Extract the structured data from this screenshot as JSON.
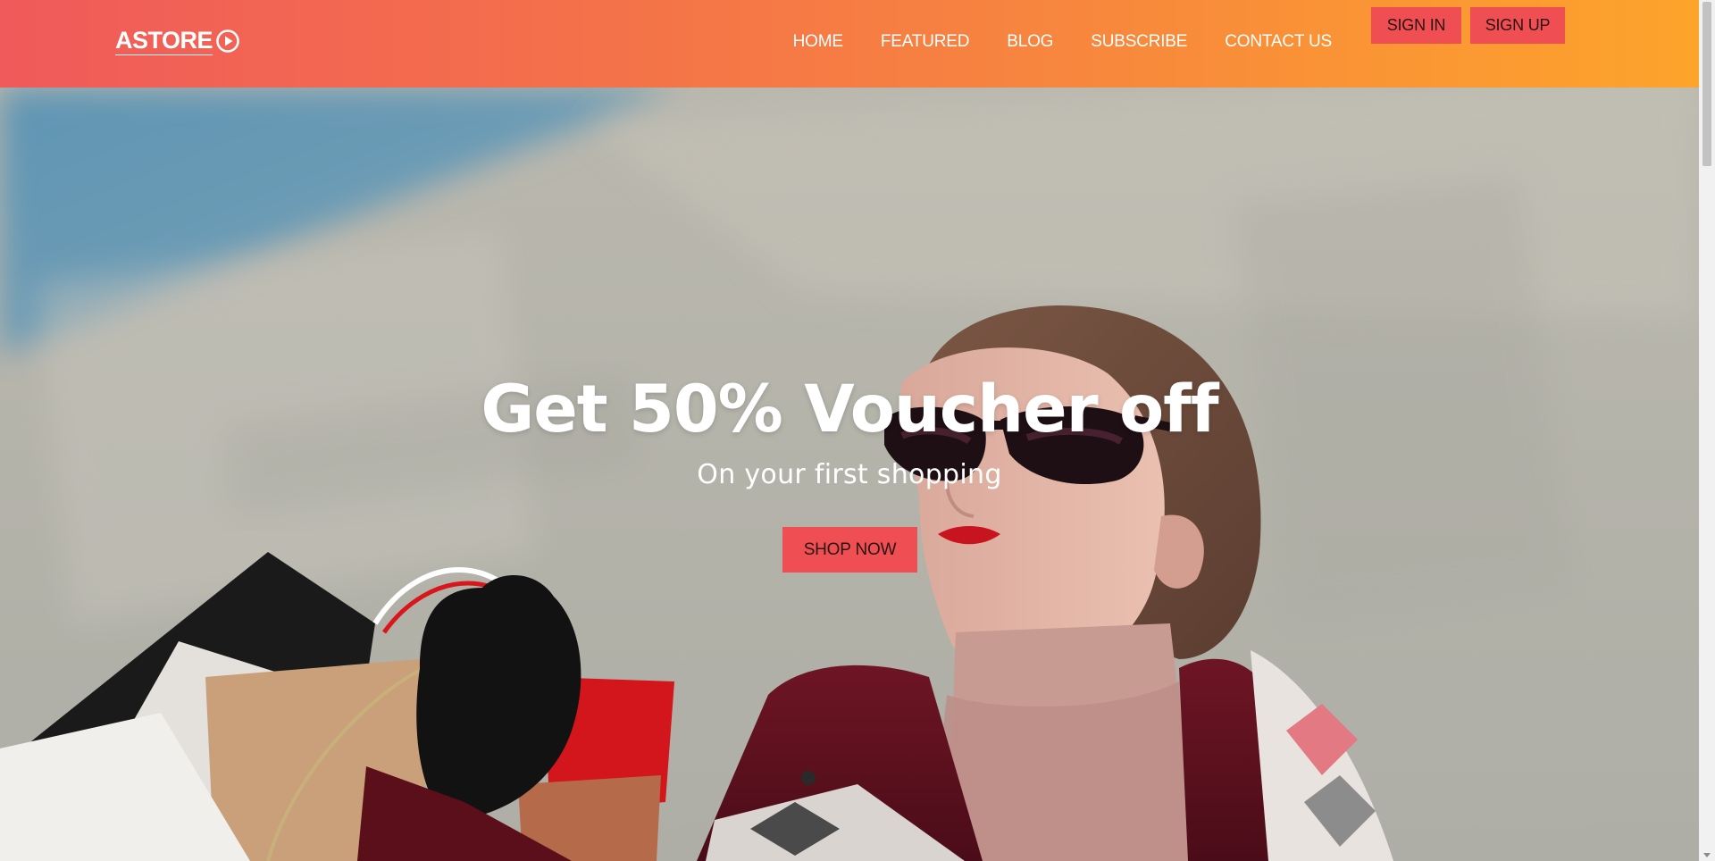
{
  "brand": {
    "name": "ASTORE",
    "logo_icon": "play-circle-icon",
    "text_color": "#ffffff"
  },
  "header": {
    "gradient": [
      "#f05a5b",
      "#f7843f",
      "#fda42b"
    ],
    "nav": [
      {
        "label": "HOME"
      },
      {
        "label": "FEATURED"
      },
      {
        "label": "BLOG"
      },
      {
        "label": "SUBSCRIBE"
      },
      {
        "label": "CONTACT US"
      }
    ],
    "sign_in": "SIGN IN",
    "sign_up": "SIGN UP"
  },
  "hero": {
    "title": "Get 50% Voucher off",
    "subtitle": "On your first shopping",
    "cta": "SHOP NOW",
    "accent": "#ef4f52",
    "image_subject": "woman-with-shopping-bags-photo"
  },
  "scrollbar": {
    "icon_down": "scroll-down-arrow-icon"
  }
}
